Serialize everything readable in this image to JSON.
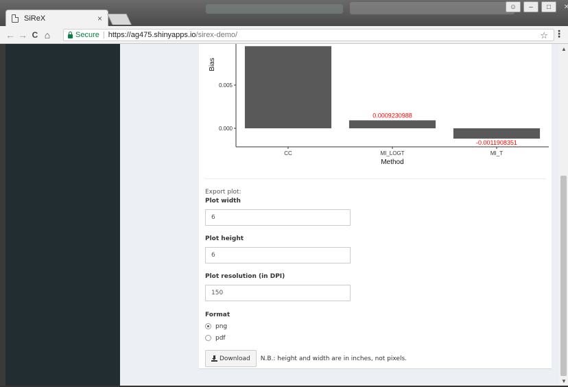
{
  "browser": {
    "tab_title": "SiReX",
    "tab_close": "×",
    "secure_label": "Secure",
    "url_host": "https://ag475.shinyapps.io",
    "url_path": "/sirex-demo/",
    "back_icon": "←",
    "forward_icon": "→",
    "reload_icon": "C",
    "home_icon": "⌂",
    "star_icon": "☆",
    "menu_icon": "⋮"
  },
  "window_controls": {
    "user_icon": "☺",
    "minimize": "–",
    "maximize": "□",
    "close": "✕"
  },
  "chart_data": {
    "type": "bar",
    "categories": [
      "CC",
      "MI_LOGT",
      "MI_T"
    ],
    "values": [
      0.0095,
      0.0009230988,
      -0.0011908351
    ],
    "data_labels": [
      "",
      "0.0009230988",
      "-0.0011908351"
    ],
    "xlabel": "Method",
    "ylabel": "Bias",
    "yticks": [
      0.0,
      0.005
    ],
    "ytick_labels": [
      "0.000",
      "0.005"
    ],
    "bar_color": "#595959",
    "label_color": "#ff0000"
  },
  "form": {
    "export_label": "Export plot:",
    "width_label": "Plot width",
    "width_value": "6",
    "height_label": "Plot height",
    "height_value": "6",
    "resolution_label": "Plot resolution (in DPI)",
    "resolution_value": "150",
    "format_label": "Format",
    "format_options": [
      "png",
      "pdf"
    ],
    "format_selected": "png",
    "download_label": "Download",
    "note": "N.B.: height and width are in inches, not pixels."
  },
  "scrollbar": {
    "up": "▲",
    "down": "▼"
  }
}
